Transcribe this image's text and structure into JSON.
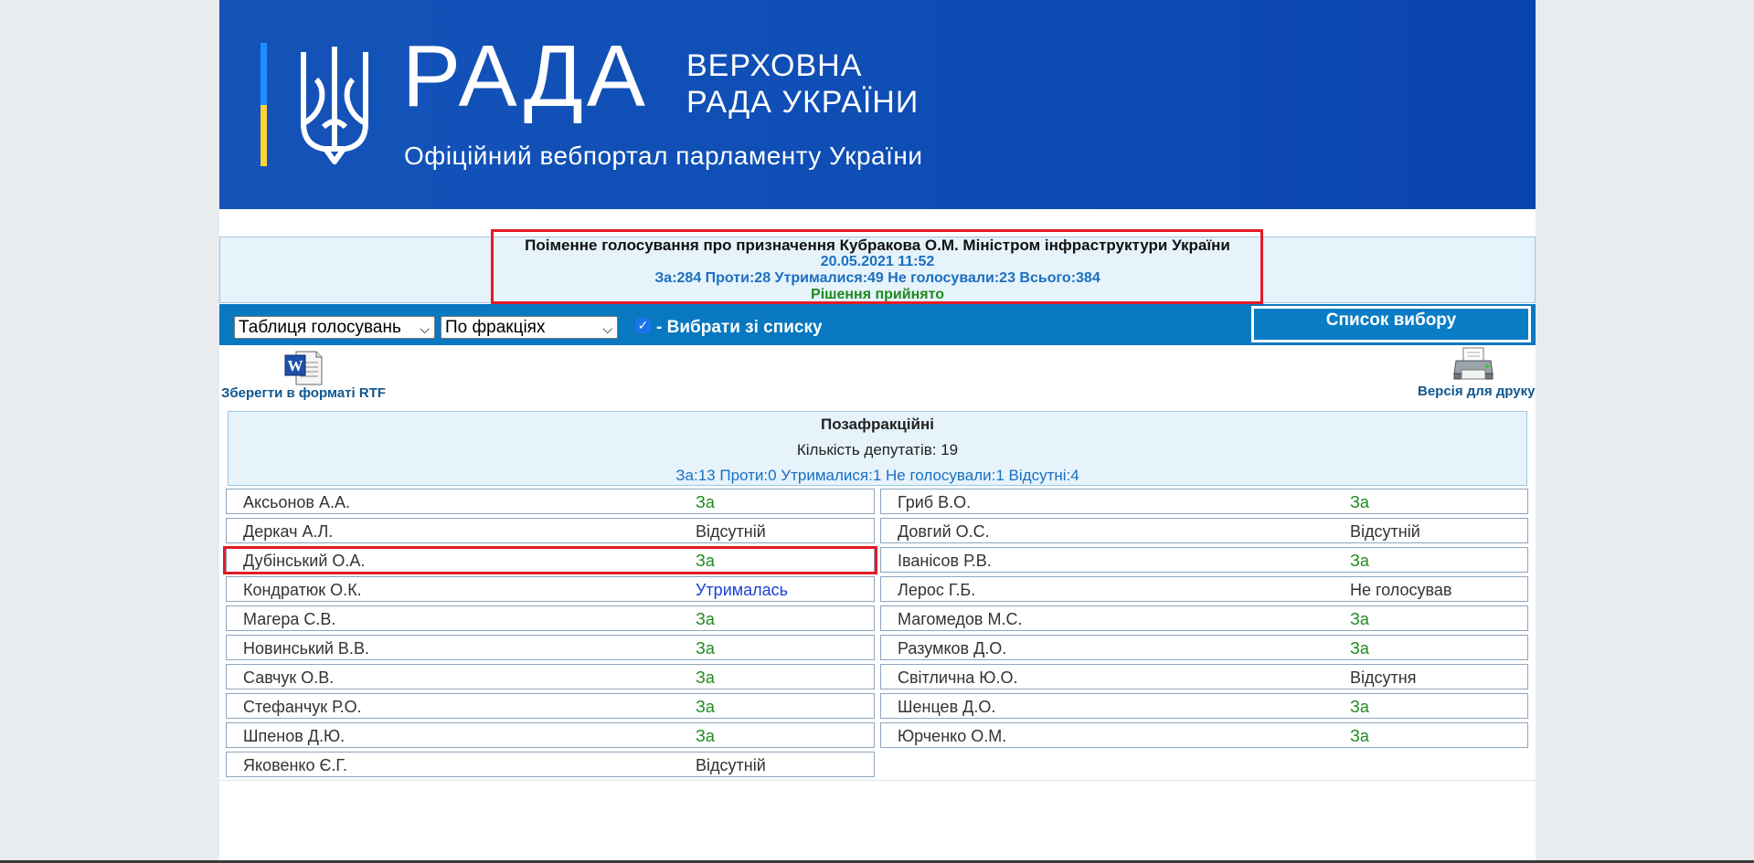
{
  "header": {
    "title": "РАДА",
    "subtitle_line1": "ВЕРХОВНА",
    "subtitle_line2": "РАДА УКРАЇНИ",
    "tagline": "Офіційний вебпортал парламенту України"
  },
  "vote": {
    "title": "Поіменне голосування про призначення Кубракова О.М. Міністром інфраструктури України",
    "datetime": "20.05.2021 11:52",
    "totals": "За:284 Проти:28 Утрималися:49 Не голосували:23 Всього:384",
    "result": "Рішення прийнято"
  },
  "toolbar": {
    "view_select": "Таблиця голосувань",
    "group_select": "По фракціях",
    "select_from_list_label": "- Вибрати зі списку",
    "select_from_list_checked": true,
    "list_button": "Список вибору"
  },
  "actions": {
    "save_rtf": "Зберегти в форматі RTF",
    "print_version": "Версія для друку"
  },
  "faction": {
    "name": "Позафракційні",
    "count": "Кількість депутатів: 19",
    "totals": "За:13 Проти:0 Утрималися:1 Не голосували:1 Відсутні:4"
  },
  "deputies_left": [
    {
      "name": "Аксьонов А.А.",
      "vote": "За"
    },
    {
      "name": "Деркач А.Л.",
      "vote": "Відсутній"
    },
    {
      "name": "Дубінський О.А.",
      "vote": "За"
    },
    {
      "name": "Кондратюк О.К.",
      "vote": "Утрималась"
    },
    {
      "name": "Магера С.В.",
      "vote": "За"
    },
    {
      "name": "Новинський В.В.",
      "vote": "За"
    },
    {
      "name": "Савчук О.В.",
      "vote": "За"
    },
    {
      "name": "Стефанчук Р.О.",
      "vote": "За"
    },
    {
      "name": "Шпенов Д.Ю.",
      "vote": "За"
    },
    {
      "name": "Яковенко Є.Г.",
      "vote": "Відсутній"
    }
  ],
  "deputies_right": [
    {
      "name": "Гриб В.О.",
      "vote": "За"
    },
    {
      "name": "Довгий О.С.",
      "vote": "Відсутній"
    },
    {
      "name": "Іванісов Р.В.",
      "vote": "За"
    },
    {
      "name": "Лерос Г.Б.",
      "vote": "Не голосував"
    },
    {
      "name": "Магомедов М.С.",
      "vote": "За"
    },
    {
      "name": "Разумков Д.О.",
      "vote": "За"
    },
    {
      "name": "Світлична Ю.О.",
      "vote": "Відсутня"
    },
    {
      "name": "Шенцев Д.О.",
      "vote": "За"
    },
    {
      "name": "Юрченко О.М.",
      "vote": "За"
    }
  ],
  "colors": {
    "header_blue": "#0f4fb6",
    "toolbar_blue": "#0878c0",
    "vote_for": "#1f8a1f",
    "vote_abstain": "#1a3fd6",
    "highlight": "#e31b23"
  }
}
